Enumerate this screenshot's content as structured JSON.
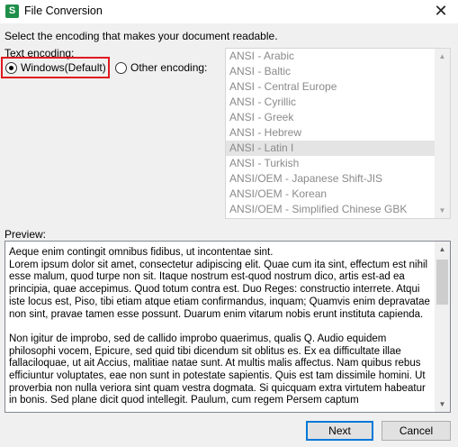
{
  "window": {
    "title": "File Conversion",
    "app_icon_glyph": "S",
    "close_glyph": "✕"
  },
  "instruction": "Select the encoding that makes your document readable.",
  "encoding": {
    "label": "Text encoding:",
    "windows_option": "Windows(Default)",
    "other_option": "Other encoding:",
    "selected": "Windows(Default)",
    "list": [
      "ANSI - Arabic",
      "ANSI - Baltic",
      "ANSI - Central Europe",
      "ANSI - Cyrillic",
      "ANSI - Greek",
      "ANSI - Hebrew",
      "ANSI - Latin I",
      "ANSI - Turkish",
      "ANSI/OEM - Japanese Shift-JIS",
      "ANSI/OEM - Korean",
      "ANSI/OEM - Simplified Chinese GBK"
    ],
    "list_selected": "ANSI - Latin I"
  },
  "preview": {
    "label": "Preview:",
    "text": "Aeque enim contingit omnibus fidibus, ut incontentae sint.\nLorem ipsum dolor sit amet, consectetur adipiscing elit. Quae cum ita sint, effectum est nihil esse malum, quod turpe non sit. Itaque nostrum est-quod nostrum dico, artis est-ad ea principia, quae accepimus. Quod totum contra est. Duo Reges: constructio interrete. Atqui iste locus est, Piso, tibi etiam atque etiam confirmandus, inquam; Quamvis enim depravatae non sint, pravae tamen esse possunt. Duarum enim vitarum nobis erunt instituta capienda.\n\nNon igitur de improbo, sed de callido improbo quaerimus, qualis Q. Audio equidem philosophi vocem, Epicure, sed quid tibi dicendum sit oblitus es. Ex ea difficultate illae fallaciloquae, ut ait Accius, malitiae natae sunt. At multis malis affectus. Nam quibus rebus efficiuntur voluptates, eae non sunt in potestate sapientis. Quis est tam dissimile homini. Ut proverbia non nulla veriora sint quam vestra dogmata. Si quicquam extra virtutem habeatur in bonis. Sed plane dicit quod intellegit. Paulum, cum regem Persem captum"
  },
  "buttons": {
    "next": "Next",
    "cancel": "Cancel"
  }
}
